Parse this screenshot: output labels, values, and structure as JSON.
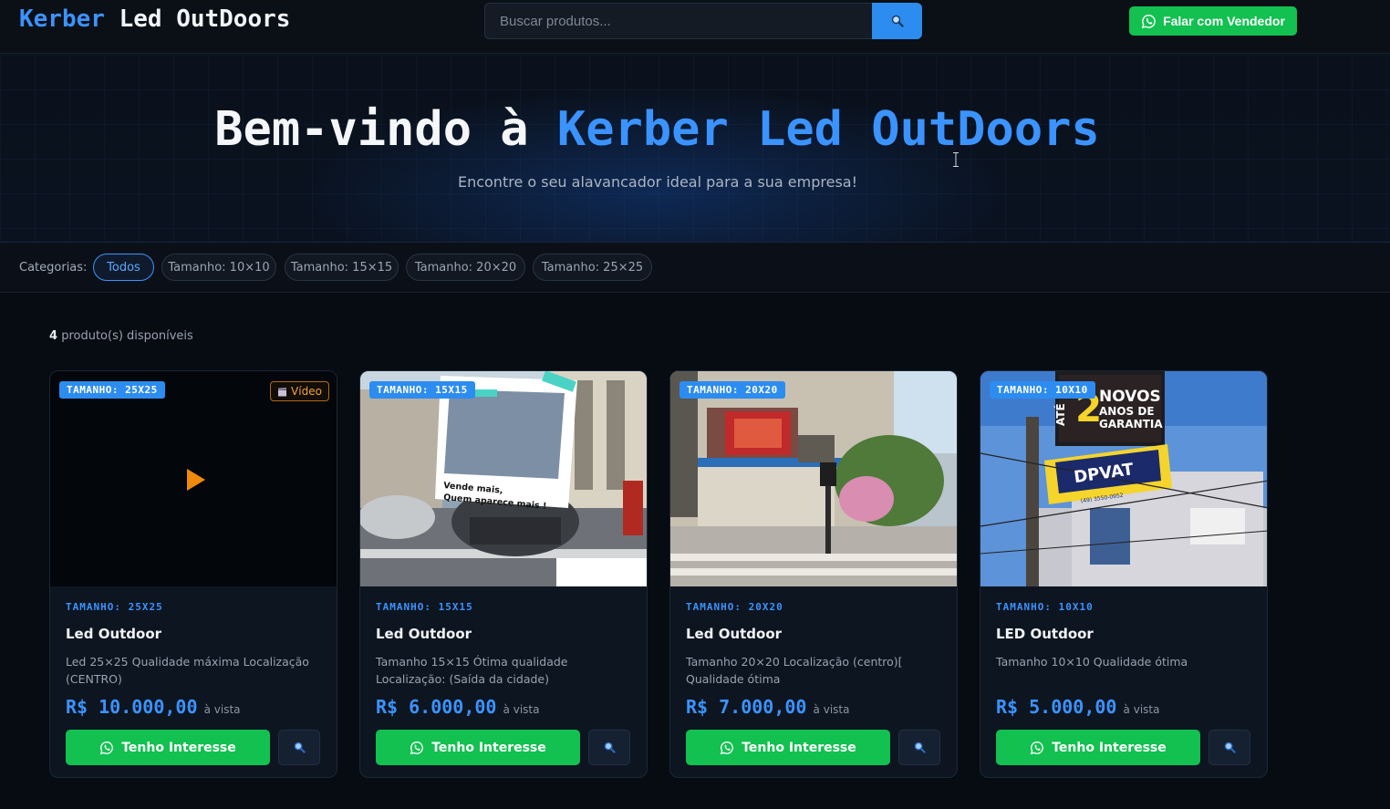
{
  "header": {
    "brand_part1": "Kerber",
    "brand_part2": "Led OutDoors",
    "search_placeholder": "Buscar produtos...",
    "talk_button": "Falar com Vendedor"
  },
  "hero": {
    "title_prefix": "Bem-vindo à",
    "title_accent": "Kerber Led OutDoors",
    "subtitle": "Encontre o seu alavancador ideal para a sua empresa!"
  },
  "categories": {
    "label": "Categorias:",
    "items": [
      {
        "label": "Todos",
        "active": true
      },
      {
        "label": "Tamanho: 10×10",
        "active": false
      },
      {
        "label": "Tamanho: 15×15",
        "active": false
      },
      {
        "label": "Tamanho: 20×20",
        "active": false
      },
      {
        "label": "Tamanho: 25×25",
        "active": false
      }
    ]
  },
  "results": {
    "count": "4",
    "label": "produto(s) disponíveis"
  },
  "products": [
    {
      "badge": "TAMANHO: 25X25",
      "video_label": "Vídeo",
      "category": "TAMANHO: 25X25",
      "title": "Led Outdoor",
      "description": "Led 25×25 Qualidade máxima Localização (CENTRO)",
      "price": "R$ 10.000,00",
      "price_note": "à vista",
      "button": "Tenho Interesse"
    },
    {
      "badge": "TAMANHO: 15X15",
      "category": "TAMANHO: 15X15",
      "title": "Led Outdoor",
      "description": "Tamanho 15×15 Ótima qualidade Localização: (Saída da cidade)",
      "image_caption": "Vende mais, Quem aparece mais !",
      "price": "R$ 6.000,00",
      "price_note": "à vista",
      "button": "Tenho Interesse"
    },
    {
      "badge": "TAMANHO: 20X20",
      "category": "TAMANHO: 20X20",
      "title": "Led Outdoor",
      "description": "Tamanho 20×20 Localização (centro)[ Qualidade ótima",
      "price": "R$ 7.000,00",
      "price_note": "à vista",
      "button": "Tenho Interesse"
    },
    {
      "badge": "TAMANHO: 10X10",
      "category": "TAMANHO: 10X10",
      "title": "LED Outdoor",
      "description": "Tamanho 10×10 Qualidade ótima",
      "image_sign_lines": [
        "ATÉ",
        "2",
        "ANOS DE",
        "GARANTIA",
        "NOVOS",
        "DPVAT",
        "(49) 3550-0952"
      ],
      "price": "R$ 5.000,00",
      "price_note": "à vista",
      "button": "Tenho Interesse"
    }
  ],
  "colors": {
    "accent": "#3b93ff",
    "whatsapp_green": "#12c150",
    "background": "#070b12",
    "video_orange": "#f08a0c"
  },
  "icons": {
    "search": "magnifier-icon",
    "whatsapp": "whatsapp-icon",
    "video": "clapperboard-icon",
    "play": "play-icon"
  }
}
